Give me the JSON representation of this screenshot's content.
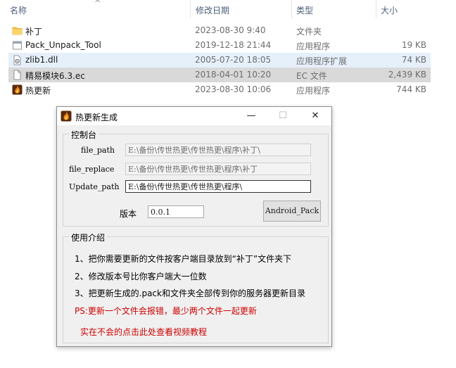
{
  "explorer": {
    "columns": {
      "name": "名称",
      "date": "修改日期",
      "type": "类型",
      "size": "大小"
    },
    "files": [
      {
        "name": "补丁",
        "date": "2023-08-30 9:40",
        "type": "文件夹",
        "size": "",
        "icon": "folder-icon"
      },
      {
        "name": "Pack_Unpack_Tool",
        "date": "2019-12-18 21:44",
        "type": "应用程序",
        "size": "19 KB",
        "icon": "app-icon"
      },
      {
        "name": "zlib1.dll",
        "date": "2005-07-20 18:05",
        "type": "应用程序扩展",
        "size": "74 KB",
        "icon": "dll-icon"
      },
      {
        "name": "精易模块6.3.ec",
        "date": "2018-04-01 10:20",
        "type": "EC 文件",
        "size": "2,439 KB",
        "icon": "document-icon"
      },
      {
        "name": "热更新",
        "date": "2023-08-30 10:06",
        "type": "应用程序",
        "size": "744 KB",
        "icon": "flame-app-icon"
      }
    ]
  },
  "dialog": {
    "title": "热更新生成",
    "title_buttons": {
      "minimize": "—",
      "maximize": "☐",
      "close": "✕"
    },
    "control_group": {
      "title": "控制台",
      "file_path_label": "file_path",
      "file_path_value": "E:\\备份\\传世热更\\传世热更\\程序\\补丁\\",
      "file_replace_label": "file_replace",
      "file_replace_value": "E:\\备份\\传世热更\\传世热更\\程序\\补丁",
      "update_path_label": "Update_path",
      "update_path_value": "E:\\备份\\传世热更\\传世热更\\程序\\",
      "version_label": "版本",
      "version_value": "0.0.1",
      "android_button": "Android_Pack"
    },
    "help_group": {
      "title": "使用介绍",
      "lines": [
        "1、把你需要更新的文件按客户端目录放到“补丁”文件夹下",
        "2、修改版本号比你客户端大一位数",
        "3、把更新生成的.pack和文件夹全部传到你的服务器更新目录"
      ],
      "warning": "PS:更新一个文件会报错，最少两个文件一起更新",
      "video_link": "实在不会的点击此处查看视频教程"
    }
  }
}
